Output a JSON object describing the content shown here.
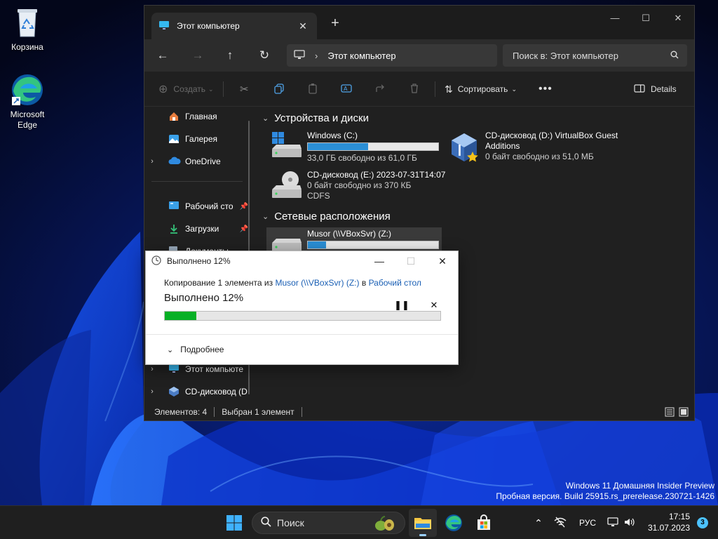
{
  "desktop": {
    "icons": [
      {
        "label": "Корзина"
      },
      {
        "label": "Microsoft\nEdge"
      }
    ]
  },
  "explorer": {
    "tab_title": "Этот компьютер",
    "address": "Этот компьютер",
    "search_placeholder": "Поиск в: Этот компьютер",
    "commands": {
      "create": "Создать",
      "sort": "Сортировать",
      "details": "Details"
    },
    "sidebar": {
      "items": [
        {
          "label": "Главная"
        },
        {
          "label": "Галерея"
        },
        {
          "label": "OneDrive"
        },
        {
          "label": "Рабочий сто"
        },
        {
          "label": "Загрузки"
        },
        {
          "label": "Документы"
        },
        {
          "label": "Этот компьюте"
        },
        {
          "label": "CD-дисковод (D"
        }
      ]
    },
    "groups": {
      "devices": "Устройства и диски",
      "network": "Сетевые расположения"
    },
    "drives": [
      {
        "name": "Windows (C:)",
        "info": "33,0 ГБ свободно из 61,0 ГБ",
        "used_fraction": 0.46
      },
      {
        "name": "CD-дисковод (D:) VirtualBox Guest Additions",
        "info": "0 байт свободно из 51,0 МБ"
      },
      {
        "name": "CD-дисковод (E:) 2023-07-31T14:07",
        "info": "0 байт свободно из 370 КБ",
        "fs": "CDFS"
      },
      {
        "name": "Musor (\\\\VBoxSvr) (Z:)",
        "used_fraction": 0.14
      }
    ],
    "status": {
      "count": "Элементов: 4",
      "selected": "Выбран 1 элемент"
    }
  },
  "copy_dialog": {
    "title": "Выполнено 12%",
    "line_prefix": "Копирование 1 элемента из",
    "source": "Musor (\\\\VBoxSvr) (Z:)",
    "line_mid": "в",
    "destination": "Рабочий стол",
    "progress_text": "Выполнено 12%",
    "progress_fraction": 0.115,
    "more_label": "Подробнее"
  },
  "watermark": {
    "line1": "Windows 11 Домашняя Insider Preview",
    "line2": "Пробная версия. Build 25915.rs_prerelease.230721-1426"
  },
  "taskbar": {
    "search_label": "Поиск",
    "language": "РУС",
    "time": "17:15",
    "date": "31.07.2023",
    "notification_count": "3"
  },
  "colors": {
    "accent": "#0078d4",
    "progress_green": "#06b025",
    "drive_bar": "#2b8fd6"
  }
}
